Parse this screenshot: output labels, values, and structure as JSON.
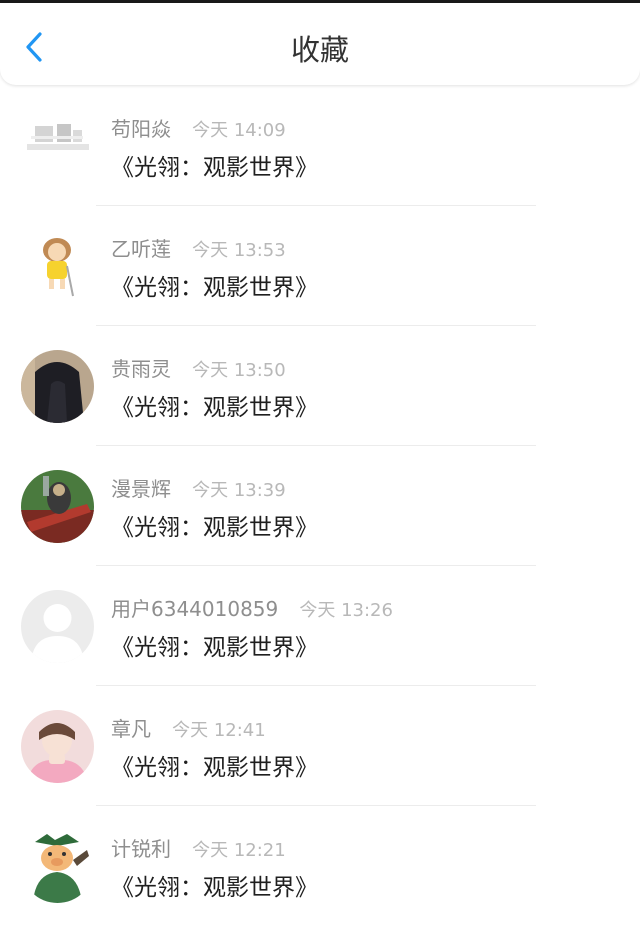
{
  "header": {
    "title": "收藏",
    "back_icon": "chevron-left-icon",
    "accent_color": "#2196f3"
  },
  "items": [
    {
      "name": "苟阳焱",
      "time": "今天 14:09",
      "content": "《光翎：观影世界》",
      "avatar": "avatar-sketch"
    },
    {
      "name": "乙听莲",
      "time": "今天 13:53",
      "content": "《光翎：观影世界》",
      "avatar": "avatar-cartoon-girl"
    },
    {
      "name": "贵雨灵",
      "time": "今天 13:50",
      "content": "《光翎：观影世界》",
      "avatar": "avatar-dark-hair"
    },
    {
      "name": "漫景辉",
      "time": "今天 13:39",
      "content": "《光翎：观影世界》",
      "avatar": "avatar-warrior"
    },
    {
      "name": "用户6344010859",
      "time": "今天 13:26",
      "content": "《光翎：观影世界》",
      "avatar": "avatar-default"
    },
    {
      "name": "章凡",
      "time": "今天 12:41",
      "content": "《光翎：观影世界》",
      "avatar": "avatar-photo-girl"
    },
    {
      "name": "计锐利",
      "time": "今天 12:21",
      "content": "《光翎：观影世界》",
      "avatar": "avatar-cartoon-pig"
    }
  ]
}
